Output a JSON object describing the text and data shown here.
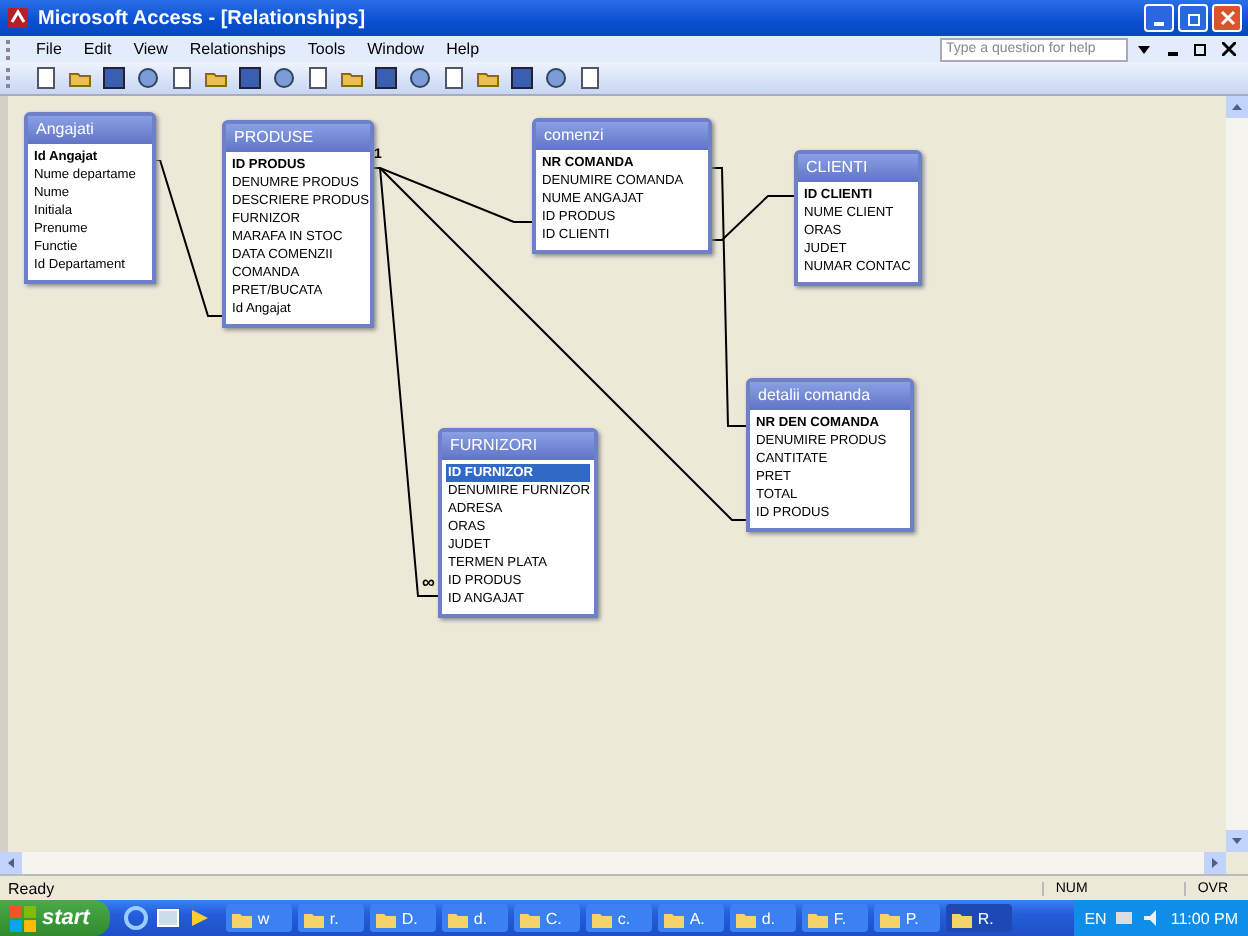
{
  "window": {
    "title": "Microsoft Access - [Relationships]"
  },
  "menu": [
    "File",
    "Edit",
    "View",
    "Relationships",
    "Tools",
    "Window",
    "Help"
  ],
  "help_box": {
    "placeholder": "Type a question for help"
  },
  "tables": [
    {
      "title": "Angajati",
      "fields": [
        {
          "name": "Id Angajat",
          "primary_key": true,
          "selected": false
        },
        {
          "name": "Nume departame",
          "primary_key": false,
          "selected": false
        },
        {
          "name": "Nume",
          "primary_key": false,
          "selected": false
        },
        {
          "name": "Initiala",
          "primary_key": false,
          "selected": false
        },
        {
          "name": "Prenume",
          "primary_key": false,
          "selected": false
        },
        {
          "name": "Functie",
          "primary_key": false,
          "selected": false
        },
        {
          "name": "Id Departament",
          "primary_key": false,
          "selected": false
        }
      ]
    },
    {
      "title": "PRODUSE",
      "fields": [
        {
          "name": "ID PRODUS",
          "primary_key": true,
          "selected": false
        },
        {
          "name": "DENUMRE PRODUS",
          "primary_key": false,
          "selected": false
        },
        {
          "name": "DESCRIERE PRODUS",
          "primary_key": false,
          "selected": false
        },
        {
          "name": "FURNIZOR",
          "primary_key": false,
          "selected": false
        },
        {
          "name": "MARAFA IN STOC",
          "primary_key": false,
          "selected": false
        },
        {
          "name": "DATA COMENZII",
          "primary_key": false,
          "selected": false
        },
        {
          "name": "COMANDA",
          "primary_key": false,
          "selected": false
        },
        {
          "name": "PRET/BUCATA",
          "primary_key": false,
          "selected": false
        },
        {
          "name": "Id Angajat",
          "primary_key": false,
          "selected": false
        }
      ]
    },
    {
      "title": "comenzi",
      "fields": [
        {
          "name": "NR COMANDA",
          "primary_key": true,
          "selected": false
        },
        {
          "name": "DENUMIRE COMANDA",
          "primary_key": false,
          "selected": false
        },
        {
          "name": "NUME ANGAJAT",
          "primary_key": false,
          "selected": false
        },
        {
          "name": "ID PRODUS",
          "primary_key": false,
          "selected": false
        },
        {
          "name": "ID CLIENTI",
          "primary_key": false,
          "selected": false
        }
      ]
    },
    {
      "title": "CLIENTI",
      "fields": [
        {
          "name": "ID CLIENTI",
          "primary_key": true,
          "selected": false
        },
        {
          "name": "NUME CLIENT",
          "primary_key": false,
          "selected": false
        },
        {
          "name": "ORAS",
          "primary_key": false,
          "selected": false
        },
        {
          "name": "JUDET",
          "primary_key": false,
          "selected": false
        },
        {
          "name": "NUMAR CONTAC",
          "primary_key": false,
          "selected": false
        }
      ]
    },
    {
      "title": "detalii comanda",
      "fields": [
        {
          "name": "NR DEN COMANDA",
          "primary_key": true,
          "selected": false
        },
        {
          "name": "DENUMIRE PRODUS",
          "primary_key": false,
          "selected": false
        },
        {
          "name": "CANTITATE",
          "primary_key": false,
          "selected": false
        },
        {
          "name": "PRET",
          "primary_key": false,
          "selected": false
        },
        {
          "name": "TOTAL",
          "primary_key": false,
          "selected": false
        },
        {
          "name": "ID PRODUS",
          "primary_key": false,
          "selected": false
        }
      ]
    },
    {
      "title": "FURNIZORI",
      "fields": [
        {
          "name": "ID FURNIZOR",
          "primary_key": true,
          "selected": true
        },
        {
          "name": "DENUMIRE FURNIZOR",
          "primary_key": false,
          "selected": false
        },
        {
          "name": "ADRESA",
          "primary_key": false,
          "selected": false
        },
        {
          "name": "ORAS",
          "primary_key": false,
          "selected": false
        },
        {
          "name": "JUDET",
          "primary_key": false,
          "selected": false
        },
        {
          "name": "TERMEN PLATA",
          "primary_key": false,
          "selected": false
        },
        {
          "name": "ID PRODUS",
          "primary_key": false,
          "selected": false
        },
        {
          "name": "ID ANGAJAT",
          "primary_key": false,
          "selected": false
        }
      ]
    }
  ],
  "join_labels": [
    "1",
    "∞"
  ],
  "status_bar": {
    "message": "Ready",
    "indicators": [
      "NUM",
      "OVR"
    ]
  },
  "taskbar": {
    "start": "start",
    "tasks": [
      {
        "label": "w",
        "selected": false
      },
      {
        "label": "r.",
        "selected": false
      },
      {
        "label": "D.",
        "selected": false
      },
      {
        "label": "d.",
        "selected": false
      },
      {
        "label": "C.",
        "selected": false
      },
      {
        "label": "c.",
        "selected": false
      },
      {
        "label": "A.",
        "selected": false
      },
      {
        "label": "d.",
        "selected": false
      },
      {
        "label": "F.",
        "selected": false
      },
      {
        "label": "P.",
        "selected": false
      },
      {
        "label": "R.",
        "selected": true
      }
    ],
    "language": "EN",
    "clock": "11:00 PM"
  }
}
